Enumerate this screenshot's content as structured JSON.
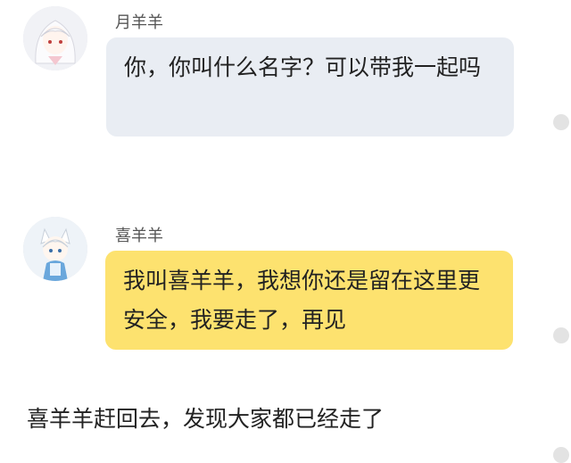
{
  "messages": [
    {
      "sender": "月羊羊",
      "text": "你，你叫什么名字？可以带我一起吗",
      "bubble_color": "#e9edf3",
      "avatar": "white-hair-girl-avatar"
    },
    {
      "sender": "喜羊羊",
      "text": "我叫喜羊羊，我想你还是留在这里更安全，我要走了，再见",
      "bubble_color": "#fde26f",
      "avatar": "blue-outfit-character-avatar"
    }
  ],
  "narration": "喜羊羊赶回去，发现大家都已经走了",
  "colors": {
    "accent_yellow": "#fde26f",
    "bubble_gray": "#e9edf3"
  }
}
